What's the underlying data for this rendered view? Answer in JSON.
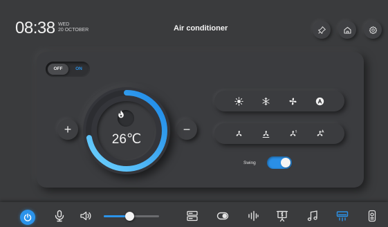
{
  "header": {
    "time": "08:38",
    "weekday": "WED",
    "date": "20 OCTOBER",
    "title": "Air conditioner",
    "icons": [
      "pin-icon",
      "home-icon",
      "settings-icon"
    ]
  },
  "power": {
    "off_label": "OFF",
    "on_label": "ON",
    "state": "off"
  },
  "thermostat": {
    "temperature": "26℃",
    "level": 0.72,
    "increase_label": "+",
    "decrease_label": "−",
    "mode_icon": "flame-icon"
  },
  "modes": [
    "sun-icon",
    "snowflake-icon",
    "fan-icon",
    "auto-icon"
  ],
  "fan_speeds": [
    "fan-low-icon",
    "fan-medium-icon",
    "fan-high-icon",
    "fan-auto-icon"
  ],
  "swing": {
    "label": "Swing",
    "enabled": true
  },
  "dock": {
    "volume_level": 0.47,
    "icons": [
      "power-icon",
      "microphone-icon",
      "speaker-icon",
      "devices-icon",
      "toggle-icon",
      "equalizer-icon",
      "presentation-icon",
      "music-icon",
      "air-conditioner-icon",
      "remote-icon"
    ]
  },
  "colors": {
    "accent": "#2b93ea",
    "background": "#3a3b3d"
  }
}
